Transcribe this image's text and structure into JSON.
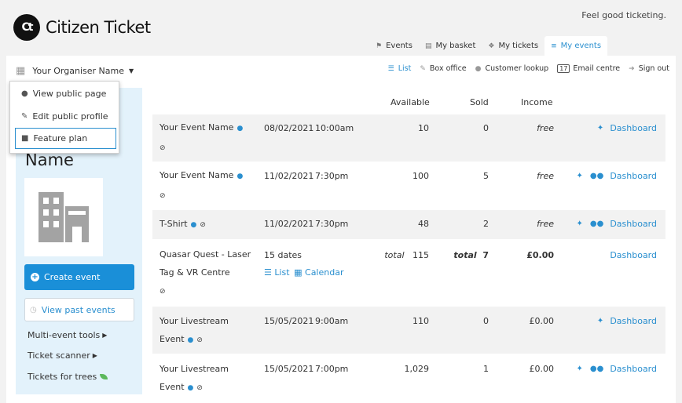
{
  "header": {
    "brand_mark": "Ct",
    "brand": "Citizen Ticket",
    "tagline": "Feel good ticketing."
  },
  "tabs": [
    {
      "label": "Events",
      "icon": "tag-icon"
    },
    {
      "label": "My basket",
      "icon": "basket-icon"
    },
    {
      "label": "My tickets",
      "icon": "ticket-icon"
    },
    {
      "label": "My events",
      "icon": "sliders-icon",
      "active": true
    }
  ],
  "organiser": {
    "name": "Your Organiser Name",
    "big_name": "Name"
  },
  "toolbar": {
    "list": "List",
    "box_office": "Box office",
    "customer_lookup": "Customer lookup",
    "email_count": "17",
    "email_centre": "Email centre",
    "sign_out": "Sign out"
  },
  "dropdown": {
    "items": [
      "View public page",
      "Edit public profile",
      "Feature plan"
    ]
  },
  "sidebar": {
    "create_event": "Create event",
    "past_events": "View past events",
    "multi_event": "Multi-event tools",
    "scanner": "Ticket scanner",
    "trees": "Tickets for trees"
  },
  "table": {
    "headers": {
      "available": "Available",
      "sold": "Sold",
      "income": "Income"
    },
    "rows": [
      {
        "name1": "Your Event Name",
        "name2": "",
        "date": "08/02/2021",
        "time": "10:00am",
        "avail_prefix": "",
        "available": "10",
        "sold_prefix": "",
        "sold": "0",
        "income": "free",
        "action": "Dashboard"
      },
      {
        "name1": "Your Event Name",
        "name2": "",
        "date": "11/02/2021",
        "time": "7:30pm",
        "avail_prefix": "",
        "available": "100",
        "sold_prefix": "",
        "sold": "5",
        "income": "free",
        "action": "Dashboard"
      },
      {
        "name1": "T-Shirt",
        "name2": "",
        "date": "11/02/2021",
        "time": "7:30pm",
        "avail_prefix": "",
        "available": "48",
        "sold_prefix": "",
        "sold": "2",
        "income": "free",
        "action": "Dashboard"
      },
      {
        "name1": "Quasar Quest - Laser",
        "name2": "Tag & VR Centre",
        "date": "15 dates",
        "time": "",
        "avail_prefix": "total",
        "available": "115",
        "sold_prefix": "total",
        "sold": "7",
        "income": "£0.00",
        "action": "Dashboard",
        "list_link": "List",
        "calendar_link": "Calendar"
      },
      {
        "name1": "Your Livestream",
        "name2": "Event",
        "date": "15/05/2021",
        "time": "9:00am",
        "avail_prefix": "",
        "available": "110",
        "sold_prefix": "",
        "sold": "0",
        "income": "£0.00",
        "action": "Dashboard"
      },
      {
        "name1": "Your Livestream",
        "name2": "Event",
        "date": "15/05/2021",
        "time": "7:00pm",
        "avail_prefix": "",
        "available": "1,029",
        "sold_prefix": "",
        "sold": "1",
        "income": "£0.00",
        "action": "Dashboard"
      }
    ]
  }
}
